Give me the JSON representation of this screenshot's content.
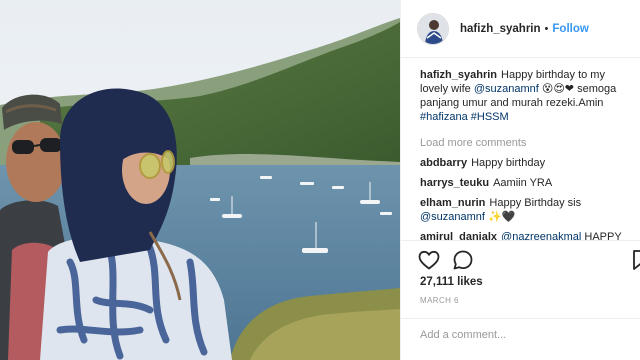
{
  "post": {
    "author": "hafizh_syahrin",
    "separator": "•",
    "follow_label": "Follow"
  },
  "caption": {
    "user": "hafizh_syahrin",
    "text_1": "Happy birthday to my lovely wife",
    "mention": "@suzanamnf",
    "emoji": "😵😍❤",
    "text_2": "semoga panjang umur and murah rezeki.Amin",
    "hashtag_1": "#hafizana",
    "hashtag_2": "#HSSM"
  },
  "load_more_label": "Load more comments",
  "comments": [
    {
      "user": "abdbarry",
      "text": "Happy birthday"
    },
    {
      "user": "harrys_teuku",
      "text": "Aamiin YRA"
    },
    {
      "user": "elham_nurin",
      "text": "Happy Birthday sis",
      "mention": "@suzanamnf",
      "emoji": "✨🖤"
    },
    {
      "user": "amirul_danialx",
      "mention": "@nazreenakmal",
      "text": "HAPPY"
    }
  ],
  "actions": {
    "like_icon": "heart-icon",
    "comment_icon": "comment-icon",
    "save_icon": "bookmark-icon"
  },
  "likes": "27,111 likes",
  "date": "MARCH 6",
  "add_comment_placeholder": "Add a comment...",
  "colors": {
    "link": "#003569",
    "follow": "#3897f0",
    "muted": "#999999",
    "text": "#262626"
  }
}
